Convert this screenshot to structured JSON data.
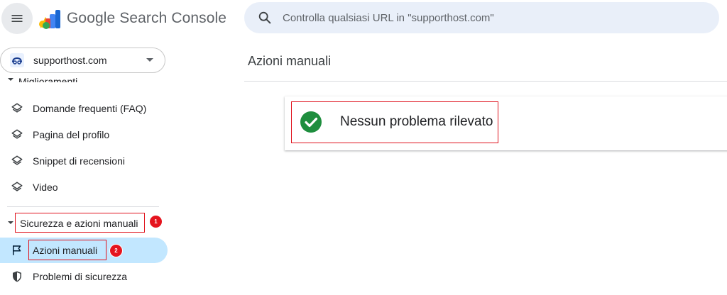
{
  "header": {
    "app_title": "Google Search Console",
    "search_placeholder": "Controlla qualsiasi URL in \"supporthost.com\""
  },
  "property": {
    "name": "supporthost.com"
  },
  "sidebar": {
    "section_improvements": "Miglioramenti",
    "items": [
      {
        "label": "Domande frequenti (FAQ)",
        "icon": "layers-icon"
      },
      {
        "label": "Pagina del profilo",
        "icon": "layers-icon"
      },
      {
        "label": "Snippet di recensioni",
        "icon": "layers-icon"
      },
      {
        "label": "Video",
        "icon": "layers-icon"
      }
    ],
    "section_security": "Sicurezza e azioni manuali",
    "security_items": [
      {
        "label": "Azioni manuali",
        "icon": "flag-icon",
        "active": true
      },
      {
        "label": "Problemi di sicurezza",
        "icon": "shield-icon",
        "active": false
      }
    ]
  },
  "annotations": {
    "badge_1": "1",
    "badge_2": "2",
    "highlight_color": "#e0141e"
  },
  "main": {
    "page_title": "Azioni manuali",
    "status_text": "Nessun problema rilevato",
    "status_color": "#1e8e3e"
  }
}
